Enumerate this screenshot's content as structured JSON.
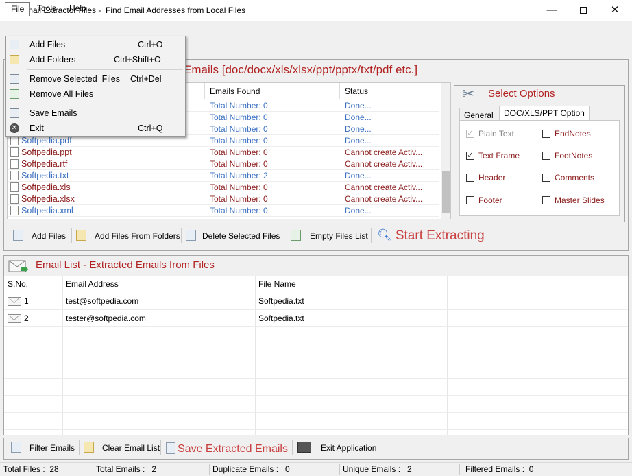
{
  "window": {
    "title": "Email Extractor Files -  Find Email Addresses from Local Files",
    "minimize_glyph": "—",
    "close_glyph": "✕"
  },
  "menubar": {
    "file": "File",
    "tools": "Tools",
    "help": "Help"
  },
  "file_menu": {
    "items": [
      {
        "label": "Add Files",
        "shortcut": "Ctrl+O",
        "icon": "add-files-icon"
      },
      {
        "label": "Add Folders",
        "shortcut": "Ctrl+Shift+O",
        "icon": "add-folders-icon"
      },
      {
        "label": "Remove Selected  Files",
        "shortcut": "Ctrl+Del",
        "icon": "remove-selected-icon"
      },
      {
        "label": "Remove All Files",
        "shortcut": "",
        "icon": "remove-all-icon"
      },
      {
        "label": "Save Emails",
        "shortcut": "",
        "icon": "save-emails-icon"
      },
      {
        "label": "Exit",
        "shortcut": "Ctrl+Q",
        "icon": "exit-icon"
      }
    ]
  },
  "files_panel": {
    "header": "Emails [doc/docx/xls/xlsx/ppt/pptx/txt/pdf etc.]",
    "columns": {
      "emails_found": "Emails Found",
      "status": "Status"
    },
    "rows": [
      {
        "name": "",
        "emails": "Total Number: 0",
        "status": "Done...",
        "color": "blue"
      },
      {
        "name": "",
        "emails": "Total Number: 0",
        "status": "Done...",
        "color": "blue"
      },
      {
        "name": "",
        "emails": "Total Number: 0",
        "status": "Done...",
        "color": "blue"
      },
      {
        "name": "Softpedia.pdf",
        "emails": "Total Number: 0",
        "status": "Done...",
        "color": "blue"
      },
      {
        "name": "Softpedia.ppt",
        "emails": "Total Number: 0",
        "status": "Cannot create Activ...",
        "color": "red"
      },
      {
        "name": "Softpedia.rtf",
        "emails": "Total Number: 0",
        "status": "Cannot create Activ...",
        "color": "red"
      },
      {
        "name": "Softpedia.txt",
        "emails": "Total Number: 2",
        "status": "Done...",
        "color": "blue"
      },
      {
        "name": "Softpedia.xls",
        "emails": "Total Number: 0",
        "status": "Cannot create Activ...",
        "color": "red"
      },
      {
        "name": "Softpedia.xlsx",
        "emails": "Total Number: 0",
        "status": "Cannot create Activ...",
        "color": "red"
      },
      {
        "name": "Softpedia.xml",
        "emails": "Total Number: 0",
        "status": "Done...",
        "color": "blue"
      }
    ]
  },
  "options": {
    "title": "Select Options",
    "tabs": {
      "general": "General",
      "doc": "DOC/XLS/PPT Option"
    },
    "checkboxes": {
      "plain_text": "Plain Text",
      "endnotes": "EndNotes",
      "text_frame": "Text Frame",
      "footnotes": "FootNotes",
      "header": "Header",
      "comments": "Comments",
      "footer": "Footer",
      "master_slides": "Master Slides"
    }
  },
  "toolbar": {
    "add_files": "Add Files",
    "add_files_from_folders": "Add Files From Folders",
    "delete_selected_files": "Delete Selected Files",
    "empty_files_list": "Empty Files List",
    "start_extracting": "Start Extracting"
  },
  "email_list": {
    "header": "Email List - Extracted Emails from Files",
    "columns": {
      "sno": "S.No.",
      "address": "Email Address",
      "file": "File Name"
    },
    "rows": [
      {
        "sno": "1",
        "address": "test@softpedia.com",
        "file": "Softpedia.txt"
      },
      {
        "sno": "2",
        "address": "tester@softpedia.com",
        "file": "Softpedia.txt"
      }
    ]
  },
  "bottom_toolbar": {
    "filter_emails": "Filter Emails",
    "clear_email_list": "Clear Email List",
    "save_extracted_emails": "Save Extracted Emails",
    "exit_application": "Exit Application"
  },
  "status": {
    "total_files": "Total Files :  28",
    "total_emails": "Total Emails :   2",
    "duplicate_emails": "Duplicate Emails :   0",
    "unique_emails": "Unique Emails :   2",
    "filtered_emails": "Filtered Emails :  0"
  },
  "colors": {
    "accent_red": "#b22222",
    "done_blue": "#3a6fc2",
    "error_red": "#8b1a1a"
  }
}
